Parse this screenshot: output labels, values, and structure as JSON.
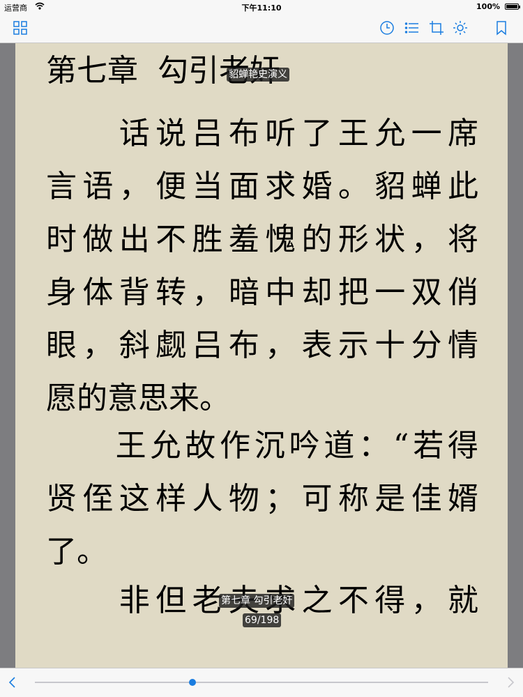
{
  "status_bar": {
    "carrier": "运营商",
    "time": "下午11:10",
    "battery": "100%"
  },
  "toolbar": {
    "icons": [
      "grid-icon",
      "clock-icon",
      "list-icon",
      "crop-icon",
      "brightness-icon",
      "bookmark-icon"
    ]
  },
  "reader": {
    "chapter_title_part1": "第七章",
    "chapter_title_part2": "勾引老奸",
    "book_title_tooltip": "貂蝉艳史演义",
    "lines": [
      "　　话说吕布听了王允一席",
      "言语，便当面求婚。貂蝉此",
      "时做出不胜羞愧的形状，将",
      "身体背转，暗中却把一双俏",
      "眼，斜觑吕布，表示十分情",
      "愿的意思来。",
      "　　王允故作沉吟道：“若得",
      "贤侄这样人物；可称是佳婿",
      "了。",
      "　　非但老夫求之不得，就"
    ],
    "chapter_tooltip": "第七章 勾引老奸",
    "page_indicator": "69/198"
  },
  "progress": {
    "current_page": 69,
    "total_pages": 198,
    "fraction": 0.348
  },
  "colors": {
    "accent": "#1a7de0",
    "paper": "#e0dac5",
    "margin": "#7d7d80"
  }
}
